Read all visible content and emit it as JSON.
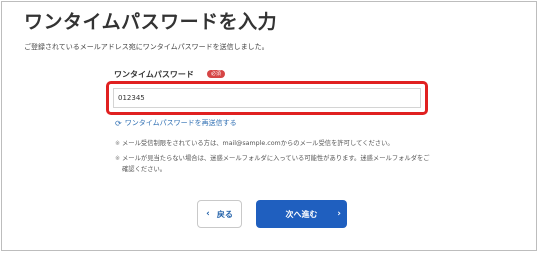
{
  "page": {
    "title": "ワンタイムパスワードを入力",
    "description": "ご登録されているメールアドレス宛にワンタイムパスワードを送信しました。"
  },
  "form": {
    "label": "ワンタイムパスワード",
    "required_badge": "必須",
    "otp_value": "012345"
  },
  "resend": {
    "label": "ワンタイムパスワードを再送信する",
    "icon": "refresh-icon"
  },
  "notes": [
    "メール受信制限をされている方は、mail@sample.comからのメール受信を許可してください。",
    "メールが見当たらない場合は、迷惑メールフォルダに入っている可能性があります。迷惑メールフォルダをご確認ください。"
  ],
  "buttons": {
    "back_label": "戻る",
    "next_label": "次へ進む"
  },
  "colors": {
    "highlight": "#e02020",
    "primary": "#1f5fbf",
    "required": "#d64545",
    "link": "#2f6fb3"
  }
}
